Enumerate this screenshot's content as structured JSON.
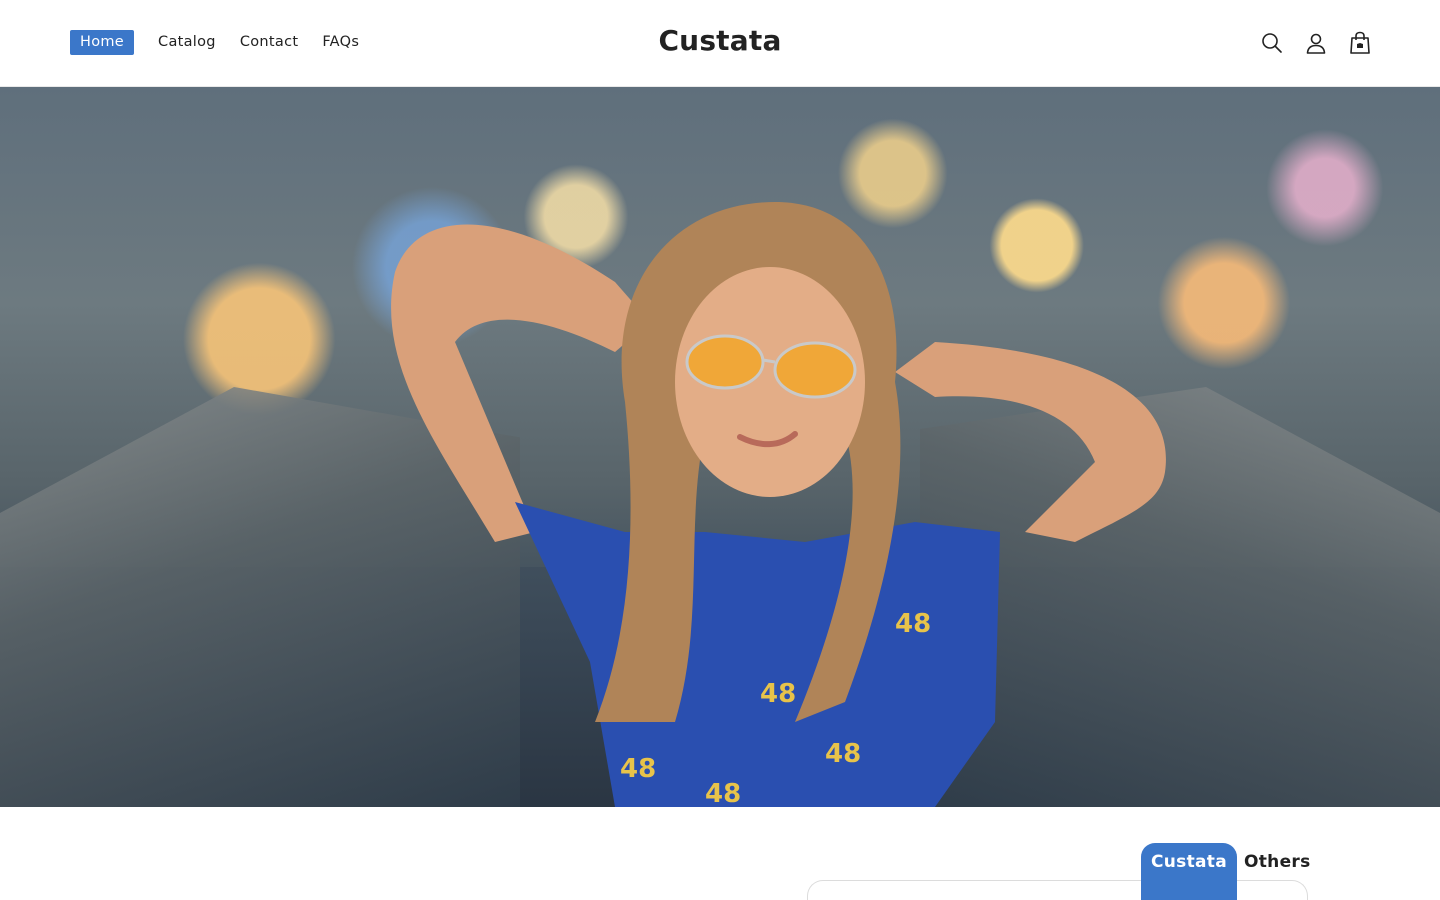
{
  "header": {
    "nav": [
      {
        "label": "Home",
        "active": true
      },
      {
        "label": "Catalog",
        "active": false
      },
      {
        "label": "Contact",
        "active": false
      },
      {
        "label": "FAQs",
        "active": false
      }
    ],
    "brand": "Custata",
    "icons": [
      "search-icon",
      "account-icon",
      "cart-icon"
    ],
    "accent_color": "#3b77c9"
  },
  "hero": {
    "image_description_alt": "",
    "shirt_number": "48"
  },
  "bottom_tabs": [
    {
      "label": "Custata",
      "active": true
    },
    {
      "label": "Others",
      "active": false
    }
  ]
}
